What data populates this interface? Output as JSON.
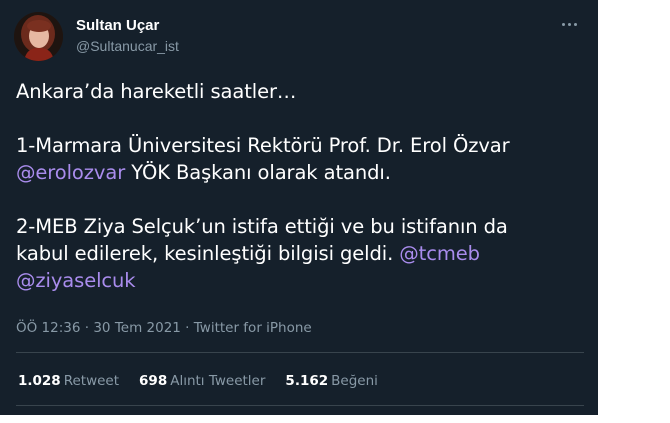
{
  "author": {
    "display_name": "Sultan Uçar",
    "handle": "@Sultanucar_ist"
  },
  "tweet": {
    "line1": "Ankara’da hareketli saatler…",
    "p2_text": "1-Marmara Üniversitesi Rektörü Prof. Dr. Erol Özvar",
    "p2_mention": "@erolozvar",
    "p2_tail": " YÖK Başkanı olarak atandı.",
    "p3_text_a": "2-MEB Ziya Selçuk’un istifa ettiği ve bu istifanın da",
    "p3_text_b": "kabul edilerek, kesinleştiği bilgisi geldi.",
    "p3_mention1": "@tcmeb",
    "p3_mention2": "@ziyaselcuk"
  },
  "meta": {
    "time": "ÖÖ 12:36",
    "sep1": "·",
    "date": "30 Tem 2021",
    "sep2": "·",
    "source": "Twitter for iPhone"
  },
  "stats": {
    "retweets_count": "1.028",
    "retweets_label": "Retweet",
    "quotes_count": "698",
    "quotes_label": "Alıntı Tweetler",
    "likes_count": "5.162",
    "likes_label": "Beğeni"
  },
  "colors": {
    "background": "#15202b",
    "mention": "#a98ced",
    "secondary_text": "#8899a6"
  },
  "icons": [
    "more-horizontal-icon"
  ]
}
